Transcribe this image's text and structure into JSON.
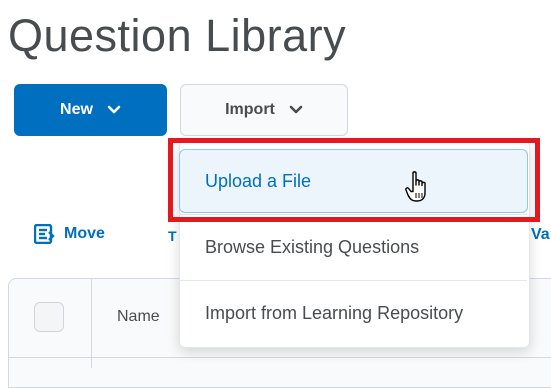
{
  "page": {
    "title": "Question Library"
  },
  "toolbar": {
    "new_label": "New",
    "import_label": "Import"
  },
  "actions": {
    "move_label": "Move",
    "partial_t": "T",
    "partial_va": "Va"
  },
  "table": {
    "name_header": "Name"
  },
  "import_menu": {
    "items": [
      {
        "label": "Upload a File",
        "highlighted": true
      },
      {
        "label": "Browse Existing Questions"
      },
      {
        "label": "Import from Learning Repository"
      }
    ]
  },
  "colors": {
    "primary": "#006fbf",
    "highlight_border": "#e2191e",
    "selected_bg": "#ebf5fb"
  },
  "icons": {
    "new_chevron": "chevron-down-icon",
    "import_chevron": "chevron-down-icon",
    "move": "move-icon",
    "cursor": "hand-pointer-cursor-icon"
  }
}
